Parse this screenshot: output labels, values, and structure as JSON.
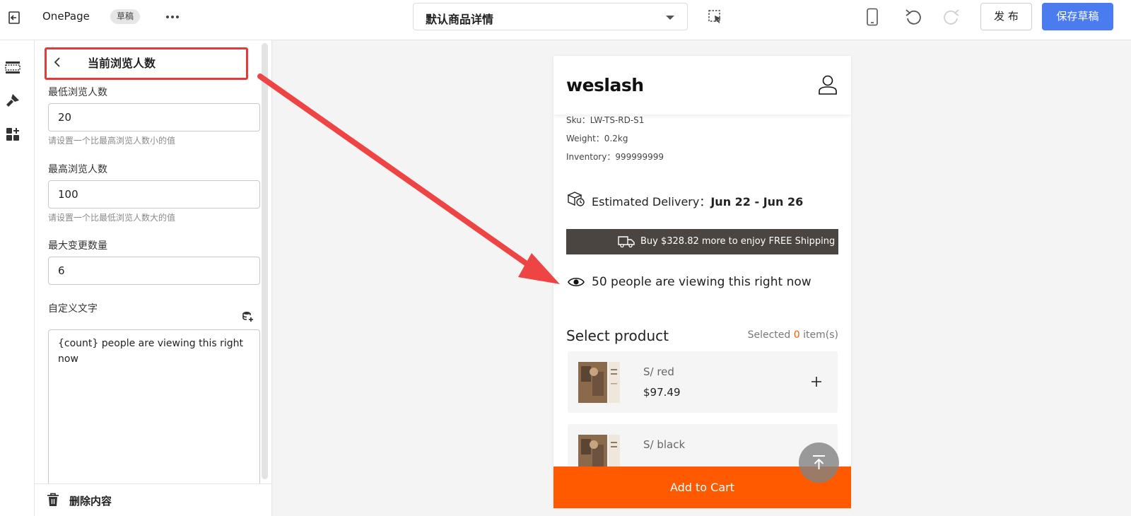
{
  "topbar": {
    "app_name": "OnePage",
    "status_badge": "草稿",
    "page_select": "默认商品详情",
    "publish_label": "发 布",
    "save_draft_label": "保存草稿"
  },
  "panel": {
    "title": "当前浏览人数",
    "min_viewers": {
      "label": "最低浏览人数",
      "value": "20",
      "hint": "请设置一个比最高浏览人数小的值"
    },
    "max_viewers": {
      "label": "最高浏览人数",
      "value": "100",
      "hint": "请设置一个比最低浏览人数大的值"
    },
    "max_change": {
      "label": "最大变更数量",
      "value": "6"
    },
    "custom_text": {
      "label": "自定义文字",
      "value": "{count} people are viewing this right now"
    },
    "delete_label": "删除内容"
  },
  "preview": {
    "logo": "weslash",
    "sku": "Sku：LW-TS-RD-S1",
    "weight": "Weight：0.2kg",
    "inventory": "Inventory：999999999",
    "delivery_label": "Estimated Delivery：",
    "delivery_dates": "Jun 22 - Jun 26",
    "shipping_banner": "Buy $328.82 more to enjoy FREE Shipping",
    "viewers_text": "50 people are viewing this right now",
    "select_title": "Select product",
    "selected_prefix": "Selected",
    "selected_count": "0",
    "selected_suffix": "item(s)",
    "products": [
      {
        "variant": "S/ red",
        "price": "$97.49"
      },
      {
        "variant": "S/ black",
        "price": ""
      }
    ],
    "add_to_cart": "Add to Cart"
  },
  "colors": {
    "accent_blue": "#4a7cf0",
    "highlight_red": "#e23b3b",
    "cart_orange": "#ff5a00",
    "banner_dark": "#4a4540"
  },
  "icons": [
    "exit-icon",
    "more-icon",
    "caret-down-icon",
    "element-selector-icon",
    "mobile-device-icon",
    "undo-icon",
    "redo-icon",
    "sections-icon",
    "theme-brush-icon",
    "apps-icon",
    "back-chevron-icon",
    "dynamic-source-icon",
    "trash-icon",
    "account-icon",
    "delivery-box-icon",
    "truck-icon",
    "eye-icon",
    "plus-icon",
    "back-to-top-icon",
    "annotation-arrow"
  ]
}
